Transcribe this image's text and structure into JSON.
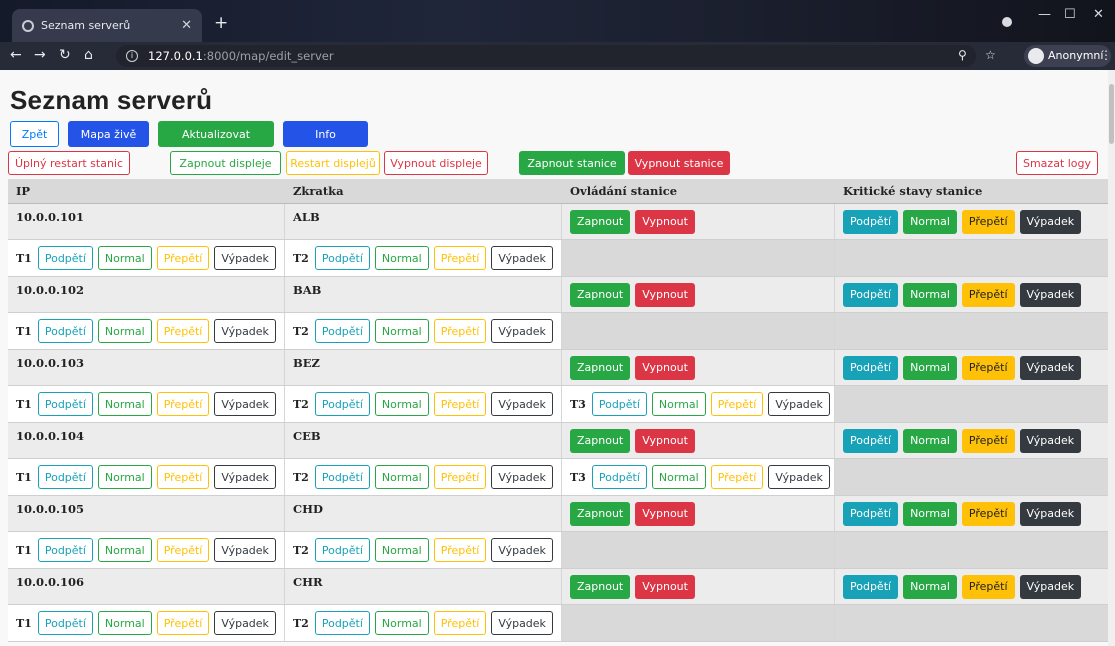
{
  "browser": {
    "tab_title": "Seznam serverů",
    "url_host": "127.0.0.1",
    "url_path": ":8000/map/edit_server",
    "profile_label": "Anonymní"
  },
  "page": {
    "title": "Seznam serverů",
    "buttons": {
      "back": "Zpět",
      "live_map": "Mapa živě",
      "refresh": "Aktualizovat",
      "info": "Info",
      "full_restart": "Úplný restart stanic",
      "displays_on": "Zapnout displeje",
      "displays_restart": "Restart displejů",
      "displays_off": "Vypnout displeje",
      "stations_on": "Zapnout stanice",
      "stations_off": "Vypnout stanice",
      "delete_logs": "Smazat logy"
    }
  },
  "table": {
    "headers": [
      "IP",
      "Zkratka",
      "Ovládání stanice",
      "Kritické stavy stanice"
    ],
    "control": {
      "on": "Zapnout",
      "off": "Vypnout"
    },
    "states": {
      "under": "Podpětí",
      "normal": "Normal",
      "over": "Přepětí",
      "outage": "Výpadek"
    },
    "rows": [
      {
        "ip": "10.0.0.101",
        "abbr": "ALB",
        "terminals": [
          "T1",
          "T2"
        ]
      },
      {
        "ip": "10.0.0.102",
        "abbr": "BAB",
        "terminals": [
          "T1",
          "T2"
        ]
      },
      {
        "ip": "10.0.0.103",
        "abbr": "BEZ",
        "terminals": [
          "T1",
          "T2",
          "T3"
        ]
      },
      {
        "ip": "10.0.0.104",
        "abbr": "CEB",
        "terminals": [
          "T1",
          "T2",
          "T3"
        ]
      },
      {
        "ip": "10.0.0.105",
        "abbr": "CHD",
        "terminals": [
          "T1",
          "T2"
        ]
      },
      {
        "ip": "10.0.0.106",
        "abbr": "CHR",
        "terminals": [
          "T1",
          "T2"
        ]
      }
    ]
  },
  "colors": {
    "success": "#28a745",
    "danger": "#dc3545",
    "info": "#17a2b8",
    "warning": "#ffc107",
    "dark": "#343a40",
    "primary": "#2453e8"
  }
}
